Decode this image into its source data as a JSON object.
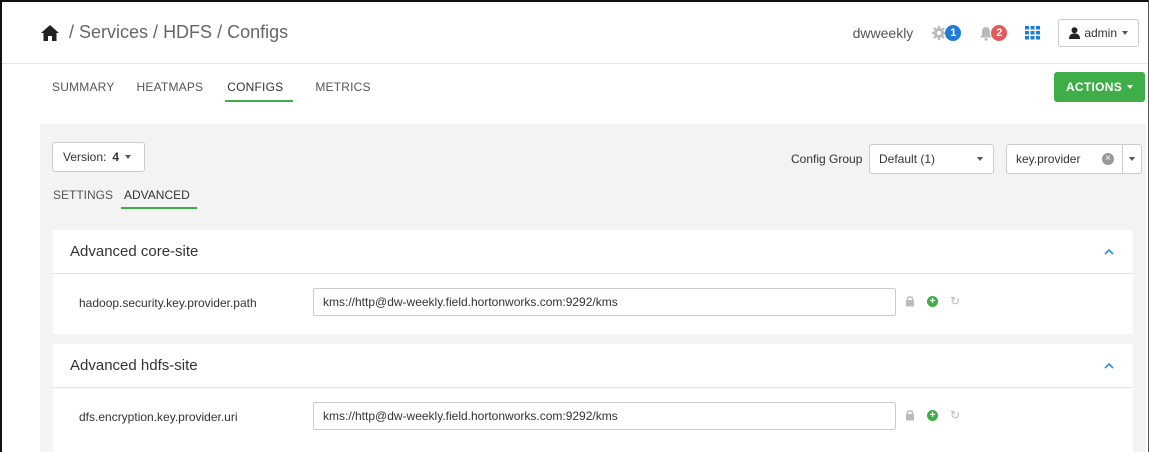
{
  "breadcrumb": {
    "services": "Services",
    "service": "HDFS",
    "page": "Configs",
    "sep": " / "
  },
  "header": {
    "cluster": "dwweekly",
    "ops_count": "1",
    "alerts_count": "2",
    "user": "admin"
  },
  "tabs": [
    "SUMMARY",
    "HEATMAPS",
    "CONFIGS",
    "METRICS"
  ],
  "actions_label": "ACTIONS",
  "version": {
    "label": "Version:",
    "value": "4"
  },
  "config_group": {
    "label": "Config Group",
    "value": "Default (1)"
  },
  "filter": {
    "value": "key.provider"
  },
  "subtabs": [
    "SETTINGS",
    "ADVANCED"
  ],
  "panels": [
    {
      "title": "Advanced core-site",
      "property": "hadoop.security.key.provider.path",
      "value": "kms://http@dw-weekly.field.hortonworks.com:9292/kms"
    },
    {
      "title": "Advanced hdfs-site",
      "property": "dfs.encryption.key.provider.uri",
      "value": "kms://http@dw-weekly.field.hortonworks.com:9292/kms"
    }
  ],
  "colors": {
    "accent": "#3fae49",
    "ops_badge": "#1e7bd8",
    "alert_badge": "#e45a5a"
  }
}
